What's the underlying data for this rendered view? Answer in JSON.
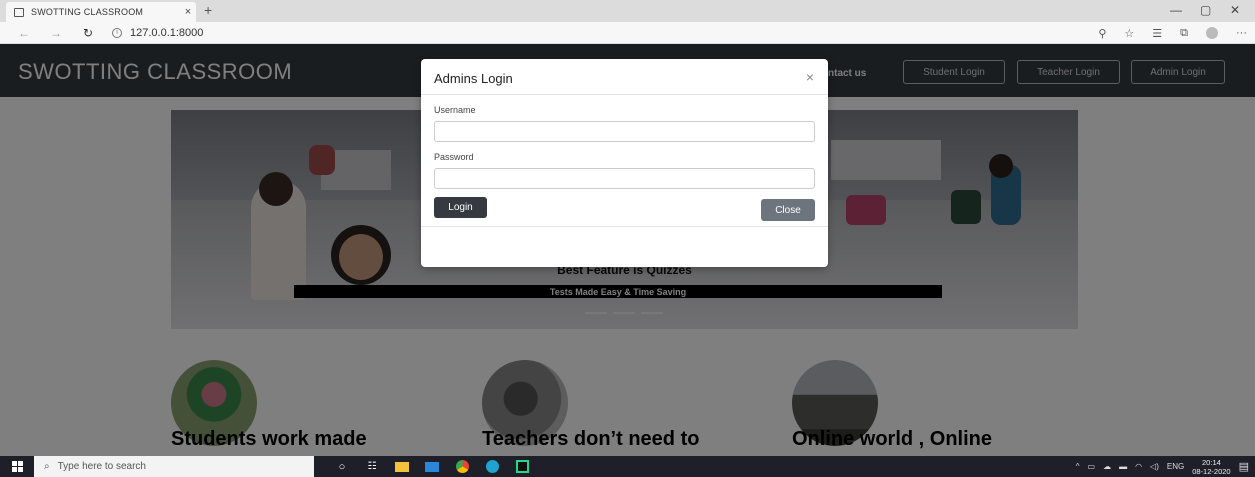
{
  "browser": {
    "tab_title": "SWOTTING CLASSROOM",
    "tab_close": "×",
    "new_tab": "+",
    "url": "127.0.0.1:8000",
    "window_controls": [
      "—",
      "▢",
      "✕"
    ]
  },
  "navbar": {
    "brand": "SWOTTING CLASSROOM",
    "contact_link": "ntact us",
    "buttons": [
      "Student Login",
      "Teacher Login",
      "Admin Login"
    ]
  },
  "carousel": {
    "caption_title": "Best Feature is Quizzes",
    "caption_text": "Tests Made Easy & Time Saving"
  },
  "features": [
    {
      "heading": "Students work made"
    },
    {
      "heading": "Teachers don’t need to"
    },
    {
      "heading": "Online world , Online"
    }
  ],
  "modal": {
    "title": "Admins Login",
    "close_x": "×",
    "username_label": "Username",
    "username_value": "",
    "password_label": "Password",
    "password_value": "",
    "login_button": "Login",
    "close_button": "Close"
  },
  "taskbar": {
    "search_placeholder": "Type here to search",
    "language": "ENG",
    "time": "20:14",
    "date": "08-12-2020"
  },
  "colors": {
    "navbar": "#343a40",
    "button_dark": "#343a40",
    "button_secondary": "#6c757d",
    "taskbar": "#1f1f2a"
  }
}
